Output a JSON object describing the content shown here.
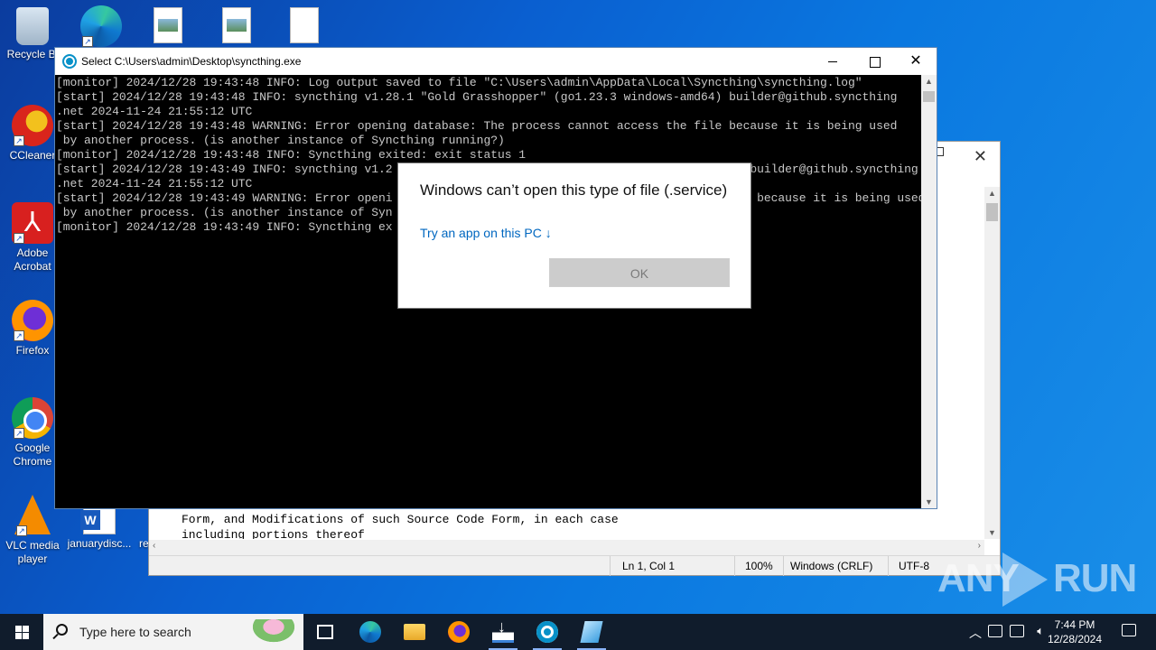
{
  "desktop": {
    "icons": [
      {
        "label": "Recycle Bi",
        "icon": "recycle-bin-icon"
      },
      {
        "label": "",
        "icon": "edge-icon"
      },
      {
        "label": "",
        "icon": "image-file-icon"
      },
      {
        "label": "",
        "icon": "image-file-icon"
      },
      {
        "label": "",
        "icon": "blank-file-icon"
      },
      {
        "label": "CCleaner",
        "icon": "ccleaner-icon"
      },
      {
        "label": "Adobe Acrobat",
        "icon": "acrobat-icon"
      },
      {
        "label": "Firefox",
        "icon": "firefox-icon"
      },
      {
        "label": "Google Chrome",
        "icon": "chrome-icon"
      },
      {
        "label": "VLC media player",
        "icon": "vlc-icon"
      },
      {
        "label": "januarydisc...",
        "icon": "word-document-icon"
      },
      {
        "label": "re",
        "icon": "file-icon"
      }
    ]
  },
  "notepad": {
    "lines": [
      "Form, and Modifications of such Source Code Form, in each case",
      "including portions thereof"
    ],
    "status": {
      "position": "Ln 1, Col 1",
      "zoom": "100%",
      "line_ending": "Windows (CRLF)",
      "encoding": "UTF-8"
    }
  },
  "console": {
    "title": "Select C:\\Users\\admin\\Desktop\\syncthing.exe",
    "lines": [
      "[monitor] 2024/12/28 19:43:48 INFO: Log output saved to file \"C:\\Users\\admin\\AppData\\Local\\Syncthing\\syncthing.log\"",
      "[start] 2024/12/28 19:43:48 INFO: syncthing v1.28.1 \"Gold Grasshopper\" (go1.23.3 windows-amd64) builder@github.syncthing",
      ".net 2024-11-24 21:55:12 UTC",
      "[start] 2024/12/28 19:43:48 WARNING: Error opening database: The process cannot access the file because it is being used",
      " by another process. (is another instance of Syncthing running?)",
      "[monitor] 2024/12/28 19:43:48 INFO: Syncthing exited: exit status 1",
      "[start] 2024/12/28 19:43:49 INFO: syncthing v1.2                                                   builder@github.syncthing",
      ".net 2024-11-24 21:55:12 UTC",
      "[start] 2024/12/28 19:43:49 WARNING: Error openi                                                    because it is being used",
      " by another process. (is another instance of Syn",
      "[monitor] 2024/12/28 19:43:49 INFO: Syncthing ex"
    ]
  },
  "dialog": {
    "heading": "Windows can’t open this type of file (.service)",
    "link": "Try an app on this PC ↓",
    "ok_label": "OK"
  },
  "watermark": {
    "left": "ANY",
    "right": "RUN"
  },
  "taskbar": {
    "search_placeholder": "Type here to search",
    "apps": [
      "task-view-icon",
      "edge-icon",
      "file-explorer-icon",
      "firefox-icon",
      "installer-icon",
      "syncthing-icon",
      "notepad-icon"
    ],
    "time": "7:44 PM",
    "date": "12/28/2024"
  }
}
